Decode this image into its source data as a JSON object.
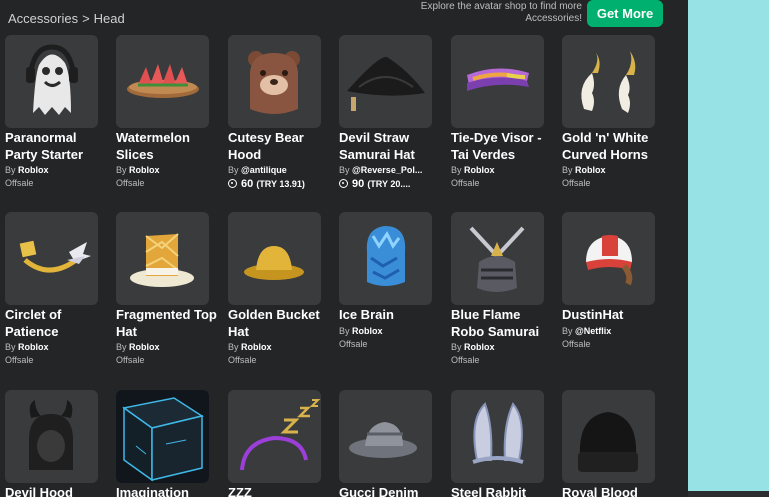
{
  "breadcrumb": {
    "parent": "Accessories",
    "separator": ">",
    "current": "Head"
  },
  "promo": {
    "text": "Explore the avatar shop to find more Accessories!",
    "button": "Get More"
  },
  "items": [
    {
      "name": "Paranormal Party Starter",
      "by": "By ",
      "creator": "Roblox",
      "status": "Offsale",
      "icon": "ghost-icon"
    },
    {
      "name": "Watermelon Slices",
      "by": "By ",
      "creator": "Roblox",
      "status": "Offsale",
      "icon": "watermelon-icon"
    },
    {
      "name": "Cutesy Bear Hood",
      "by": "By ",
      "creator": "@antilique",
      "price": "60",
      "try": "(TRY 13.91)",
      "icon": "bear-hood-icon"
    },
    {
      "name": "Devil Straw Samurai Hat",
      "by": "By ",
      "creator": "@Reverse_Pol...",
      "price": "90",
      "try": "(TRY 20....",
      "icon": "samurai-hat-icon"
    },
    {
      "name": "Tie-Dye Visor - Tai Verdes",
      "by": "By ",
      "creator": "Roblox",
      "status": "Offsale",
      "icon": "visor-icon"
    },
    {
      "name": "Gold 'n' White Curved Horns",
      "by": "By ",
      "creator": "Roblox",
      "status": "Offsale",
      "icon": "horns-icon"
    },
    {
      "name": "Circlet of Patience",
      "by": "By ",
      "creator": "Roblox",
      "status": "Offsale",
      "icon": "circlet-icon"
    },
    {
      "name": "Fragmented Top Hat",
      "by": "By ",
      "creator": "Roblox",
      "status": "Offsale",
      "icon": "top-hat-icon"
    },
    {
      "name": "Golden Bucket Hat",
      "by": "By ",
      "creator": "Roblox",
      "status": "Offsale",
      "icon": "bucket-hat-icon"
    },
    {
      "name": "Ice Brain",
      "by": "By ",
      "creator": "Roblox",
      "status": "Offsale",
      "icon": "ice-brain-icon"
    },
    {
      "name": "Blue Flame Robo Samurai",
      "by": "By ",
      "creator": "Roblox",
      "status": "Offsale",
      "icon": "robo-samurai-icon"
    },
    {
      "name": "DustinHat",
      "by": "By ",
      "creator": "@Netflix",
      "status": "Offsale",
      "icon": "cap-icon"
    },
    {
      "name": "Devil Hood",
      "icon": "devil-hood-icon"
    },
    {
      "name": "Imagination",
      "icon": "cube-icon"
    },
    {
      "name": "ZZZ",
      "icon": "zzz-icon"
    },
    {
      "name": "Gucci Denim",
      "icon": "denim-hat-icon"
    },
    {
      "name": "Steel Rabbit",
      "icon": "rabbit-ears-icon"
    },
    {
      "name": "Royal Blood",
      "icon": "beanie-icon"
    }
  ]
}
